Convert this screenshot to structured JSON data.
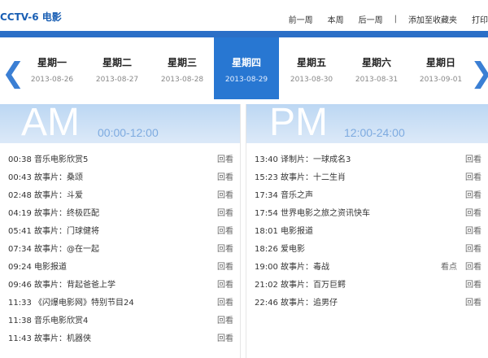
{
  "header": {
    "channel": "CCTV-6 电影",
    "links": [
      "前一周",
      "本周",
      "后一周",
      "添加至收藏夹",
      "打印"
    ],
    "separator": "|"
  },
  "nav": {
    "prev_arrow": "❮",
    "next_arrow": "❯"
  },
  "days": [
    {
      "name": "星期一",
      "date": "2013-08-26"
    },
    {
      "name": "星期二",
      "date": "2013-08-27"
    },
    {
      "name": "星期三",
      "date": "2013-08-28"
    },
    {
      "name": "星期四",
      "date": "2013-08-29"
    },
    {
      "name": "星期五",
      "date": "2013-08-30"
    },
    {
      "name": "星期六",
      "date": "2013-08-31"
    },
    {
      "name": "星期日",
      "date": "2013-09-01"
    }
  ],
  "active_day": "星期四",
  "colors": {
    "accent": "#2b6fc7",
    "active_day_bg": "#2877d2"
  },
  "am": {
    "label": "AM",
    "range": "00:00-12:00",
    "items": [
      {
        "time": "00:38",
        "title": "音乐电影欣赏5",
        "replay": "回看"
      },
      {
        "time": "00:43",
        "title": "故事片：桑颂",
        "replay": "回看"
      },
      {
        "time": "02:48",
        "title": "故事片：斗爱",
        "replay": "回看"
      },
      {
        "time": "04:19",
        "title": "故事片：终极匹配",
        "replay": "回看"
      },
      {
        "time": "05:41",
        "title": "故事片：门球健将",
        "replay": "回看"
      },
      {
        "time": "07:34",
        "title": "故事片：@在一起",
        "replay": "回看"
      },
      {
        "time": "09:24",
        "title": "电影报道",
        "replay": "回看"
      },
      {
        "time": "09:46",
        "title": "故事片：背起爸爸上学",
        "replay": "回看"
      },
      {
        "time": "11:33",
        "title": "《闪爆电影网》特别节目24",
        "replay": "回看"
      },
      {
        "time": "11:38",
        "title": "音乐电影欣赏4",
        "replay": "回看"
      },
      {
        "time": "11:43",
        "title": "故事片：机器侠",
        "replay": "回看"
      }
    ]
  },
  "pm": {
    "label": "PM",
    "range": "12:00-24:00",
    "items": [
      {
        "time": "13:40",
        "title": "译制片：一球成名3",
        "replay": "回看"
      },
      {
        "time": "15:23",
        "title": "故事片：十二生肖",
        "replay": "回看"
      },
      {
        "time": "17:34",
        "title": "音乐之声",
        "replay": "回看"
      },
      {
        "time": "17:54",
        "title": "世界电影之旅之资讯快车",
        "replay": "回看"
      },
      {
        "time": "18:01",
        "title": "电影报道",
        "replay": "回看"
      },
      {
        "time": "18:26",
        "title": "爱电影",
        "replay": "回看"
      },
      {
        "time": "19:00",
        "title": "故事片：毒战",
        "watch": "看点",
        "replay": "回看"
      },
      {
        "time": "21:02",
        "title": "故事片：百万巨鳄",
        "replay": "回看"
      },
      {
        "time": "22:46",
        "title": "故事片：追男仔",
        "replay": "回看"
      }
    ]
  }
}
